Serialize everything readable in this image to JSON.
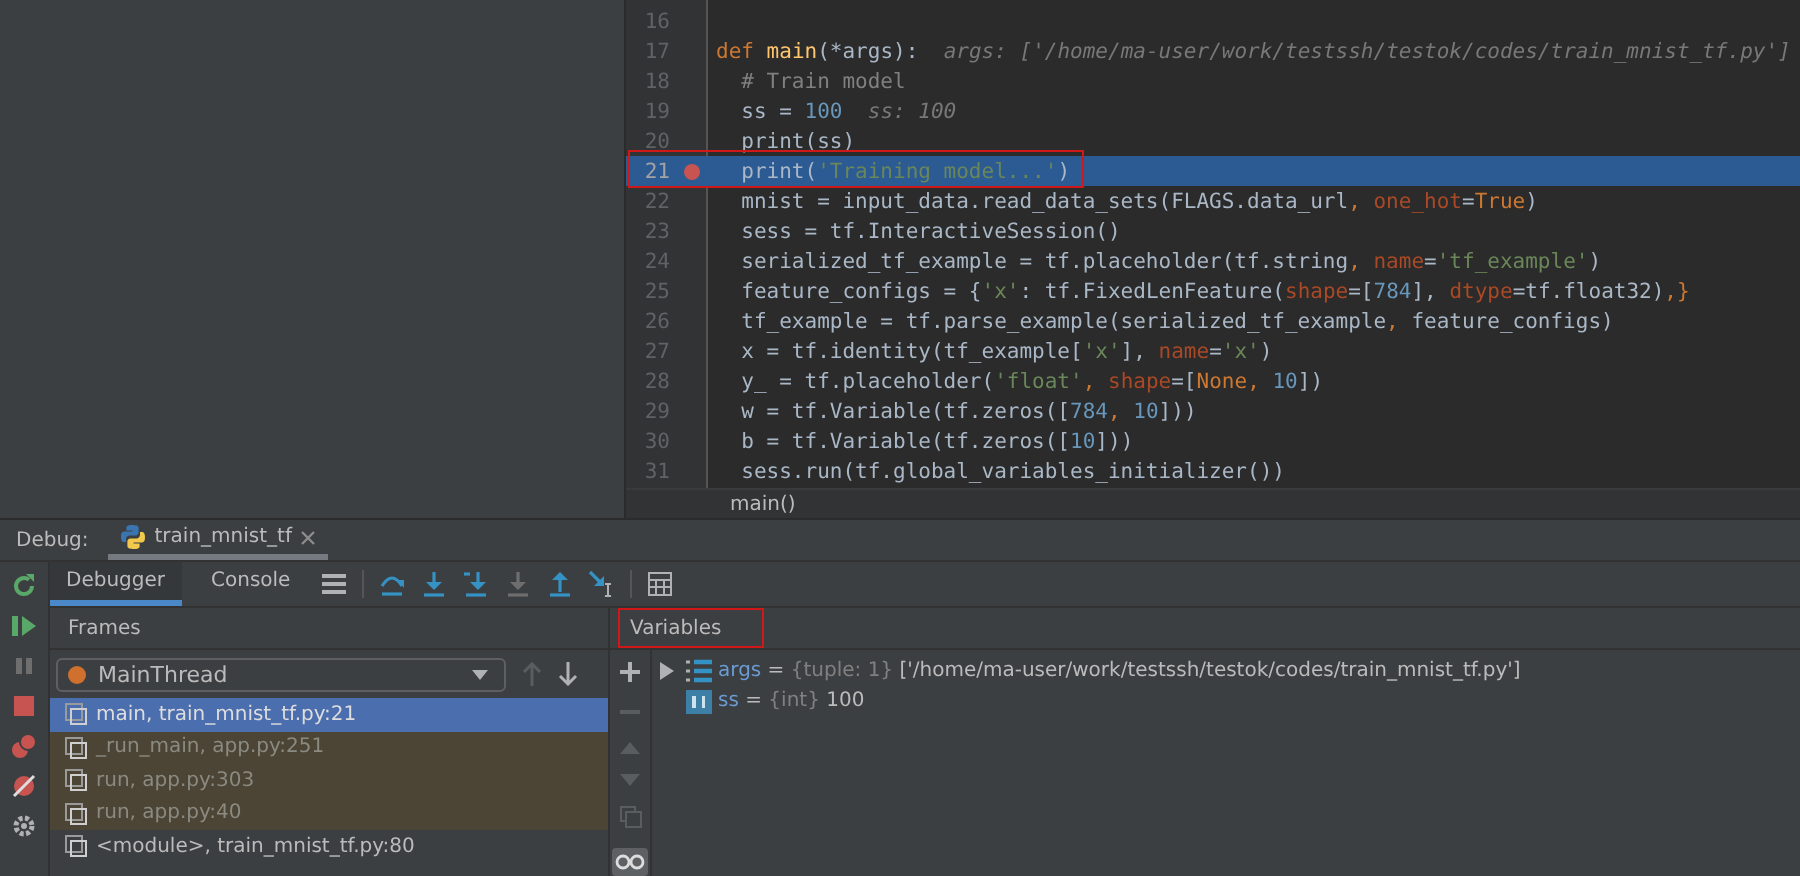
{
  "editor": {
    "lines": [
      {
        "number": "16",
        "breakpoint": false,
        "current": false
      },
      {
        "number": "17",
        "breakpoint": false,
        "current": false,
        "tokens": [
          {
            "text": "def ",
            "kind": "keyword"
          },
          {
            "text": "main",
            "kind": "function"
          },
          {
            "text": "(*args):",
            "kind": "plain"
          },
          {
            "text": "  args: ['/home/ma-user/work/testssh/testok/codes/train_mnist_tf.py']",
            "kind": "hint"
          }
        ]
      },
      {
        "number": "18",
        "breakpoint": false,
        "current": false,
        "tokens": [
          {
            "text": "  # Train model",
            "kind": "comment"
          }
        ]
      },
      {
        "number": "19",
        "breakpoint": false,
        "current": false,
        "tokens": [
          {
            "text": "  ss = ",
            "kind": "plain"
          },
          {
            "text": "100",
            "kind": "number"
          },
          {
            "text": "  ss: 100",
            "kind": "hint"
          }
        ]
      },
      {
        "number": "20",
        "breakpoint": false,
        "current": false,
        "tokens": [
          {
            "text": "  print(ss)",
            "kind": "plain"
          }
        ]
      },
      {
        "number": "21",
        "breakpoint": true,
        "current": true,
        "tokens": [
          {
            "text": "  print(",
            "kind": "plain"
          },
          {
            "text": "'Training model...'",
            "kind": "string"
          },
          {
            "text": ")",
            "kind": "plain"
          }
        ]
      },
      {
        "number": "22",
        "breakpoint": false,
        "current": false,
        "tokens": [
          {
            "text": "  mnist = input_data.read_data_sets(FLAGS.data_url",
            "kind": "plain"
          },
          {
            "text": ", ",
            "kind": "keyword"
          },
          {
            "text": "one_hot",
            "kind": "kwarg"
          },
          {
            "text": "=",
            "kind": "plain"
          },
          {
            "text": "True",
            "kind": "keyword"
          },
          {
            "text": ")",
            "kind": "plain"
          }
        ]
      },
      {
        "number": "23",
        "breakpoint": false,
        "current": false,
        "tokens": [
          {
            "text": "  sess = tf.InteractiveSession()",
            "kind": "plain"
          }
        ]
      },
      {
        "number": "24",
        "breakpoint": false,
        "current": false,
        "tokens": [
          {
            "text": "  serialized_tf_example = tf.placeholder(tf.string",
            "kind": "plain"
          },
          {
            "text": ", ",
            "kind": "keyword"
          },
          {
            "text": "name",
            "kind": "kwarg"
          },
          {
            "text": "=",
            "kind": "plain"
          },
          {
            "text": "'tf_example'",
            "kind": "string"
          },
          {
            "text": ")",
            "kind": "plain"
          }
        ]
      },
      {
        "number": "25",
        "breakpoint": false,
        "current": false,
        "tokens": [
          {
            "text": "  feature_configs = {",
            "kind": "plain"
          },
          {
            "text": "'x'",
            "kind": "string"
          },
          {
            "text": ": tf.FixedLenFeature(",
            "kind": "plain"
          },
          {
            "text": "shape",
            "kind": "kwarg"
          },
          {
            "text": "=[",
            "kind": "plain"
          },
          {
            "text": "784",
            "kind": "number"
          },
          {
            "text": "], ",
            "kind": "plain"
          },
          {
            "text": "dtype",
            "kind": "kwarg"
          },
          {
            "text": "=tf.float32)",
            "kind": "plain"
          },
          {
            "text": ",}",
            "kind": "keyword"
          }
        ]
      },
      {
        "number": "26",
        "breakpoint": false,
        "current": false,
        "tokens": [
          {
            "text": "  tf_example = tf.parse_example(serialized_tf_example",
            "kind": "plain"
          },
          {
            "text": ", ",
            "kind": "keyword"
          },
          {
            "text": "feature_configs)",
            "kind": "plain"
          }
        ]
      },
      {
        "number": "27",
        "breakpoint": false,
        "current": false,
        "tokens": [
          {
            "text": "  x = tf.identity(tf_example[",
            "kind": "plain"
          },
          {
            "text": "'x'",
            "kind": "string"
          },
          {
            "text": "], ",
            "kind": "plain"
          },
          {
            "text": "name",
            "kind": "kwarg"
          },
          {
            "text": "=",
            "kind": "plain"
          },
          {
            "text": "'x'",
            "kind": "string"
          },
          {
            "text": ")",
            "kind": "plain"
          }
        ]
      },
      {
        "number": "28",
        "breakpoint": false,
        "current": false,
        "tokens": [
          {
            "text": "  y_ = tf.placeholder(",
            "kind": "plain"
          },
          {
            "text": "'float'",
            "kind": "string"
          },
          {
            "text": ", ",
            "kind": "keyword"
          },
          {
            "text": "shape",
            "kind": "kwarg"
          },
          {
            "text": "=[",
            "kind": "plain"
          },
          {
            "text": "None",
            "kind": "keyword"
          },
          {
            "text": ", ",
            "kind": "keyword"
          },
          {
            "text": "10",
            "kind": "number"
          },
          {
            "text": "])",
            "kind": "plain"
          }
        ]
      },
      {
        "number": "29",
        "breakpoint": false,
        "current": false,
        "tokens": [
          {
            "text": "  w = tf.Variable(tf.zeros([",
            "kind": "plain"
          },
          {
            "text": "784",
            "kind": "number"
          },
          {
            "text": ", ",
            "kind": "keyword"
          },
          {
            "text": "10",
            "kind": "number"
          },
          {
            "text": "]))",
            "kind": "plain"
          }
        ]
      },
      {
        "number": "30",
        "breakpoint": false,
        "current": false,
        "tokens": [
          {
            "text": "  b = tf.Variable(tf.zeros([",
            "kind": "plain"
          },
          {
            "text": "10",
            "kind": "number"
          },
          {
            "text": "]))",
            "kind": "plain"
          }
        ]
      },
      {
        "number": "31",
        "breakpoint": false,
        "current": false,
        "tokens": [
          {
            "text": "  sess.run(tf.global_variables_initializer())",
            "kind": "plain"
          }
        ]
      }
    ],
    "breadcrumb": "main()"
  },
  "debug": {
    "label": "Debug:",
    "session_tab": {
      "label": "train_mnist_tf",
      "selected": true
    },
    "tabs": [
      {
        "label": "Debugger",
        "selected": true
      },
      {
        "label": "Console",
        "selected": false
      }
    ],
    "frames": {
      "title": "Frames",
      "thread": "MainThread",
      "items": [
        {
          "label": "main, train_mnist_tf.py:21",
          "selected": true,
          "library": false
        },
        {
          "label": "_run_main, app.py:251",
          "selected": false,
          "library": true
        },
        {
          "label": "run, app.py:303",
          "selected": false,
          "library": true
        },
        {
          "label": "run, app.py:40",
          "selected": false,
          "library": true
        },
        {
          "label": "<module>, train_mnist_tf.py:80",
          "selected": false,
          "library": false
        }
      ]
    },
    "variables": {
      "title": "Variables",
      "items": [
        {
          "kind": "list",
          "name": "args",
          "operator": "=",
          "type": "{tuple: 1}",
          "value": "['/home/ma-user/work/testssh/testok/codes/train_mnist_tf.py']",
          "expandable": true
        },
        {
          "kind": "int",
          "name": "ss",
          "operator": "=",
          "type": "{int}",
          "value": "100",
          "expandable": false
        }
      ]
    }
  }
}
